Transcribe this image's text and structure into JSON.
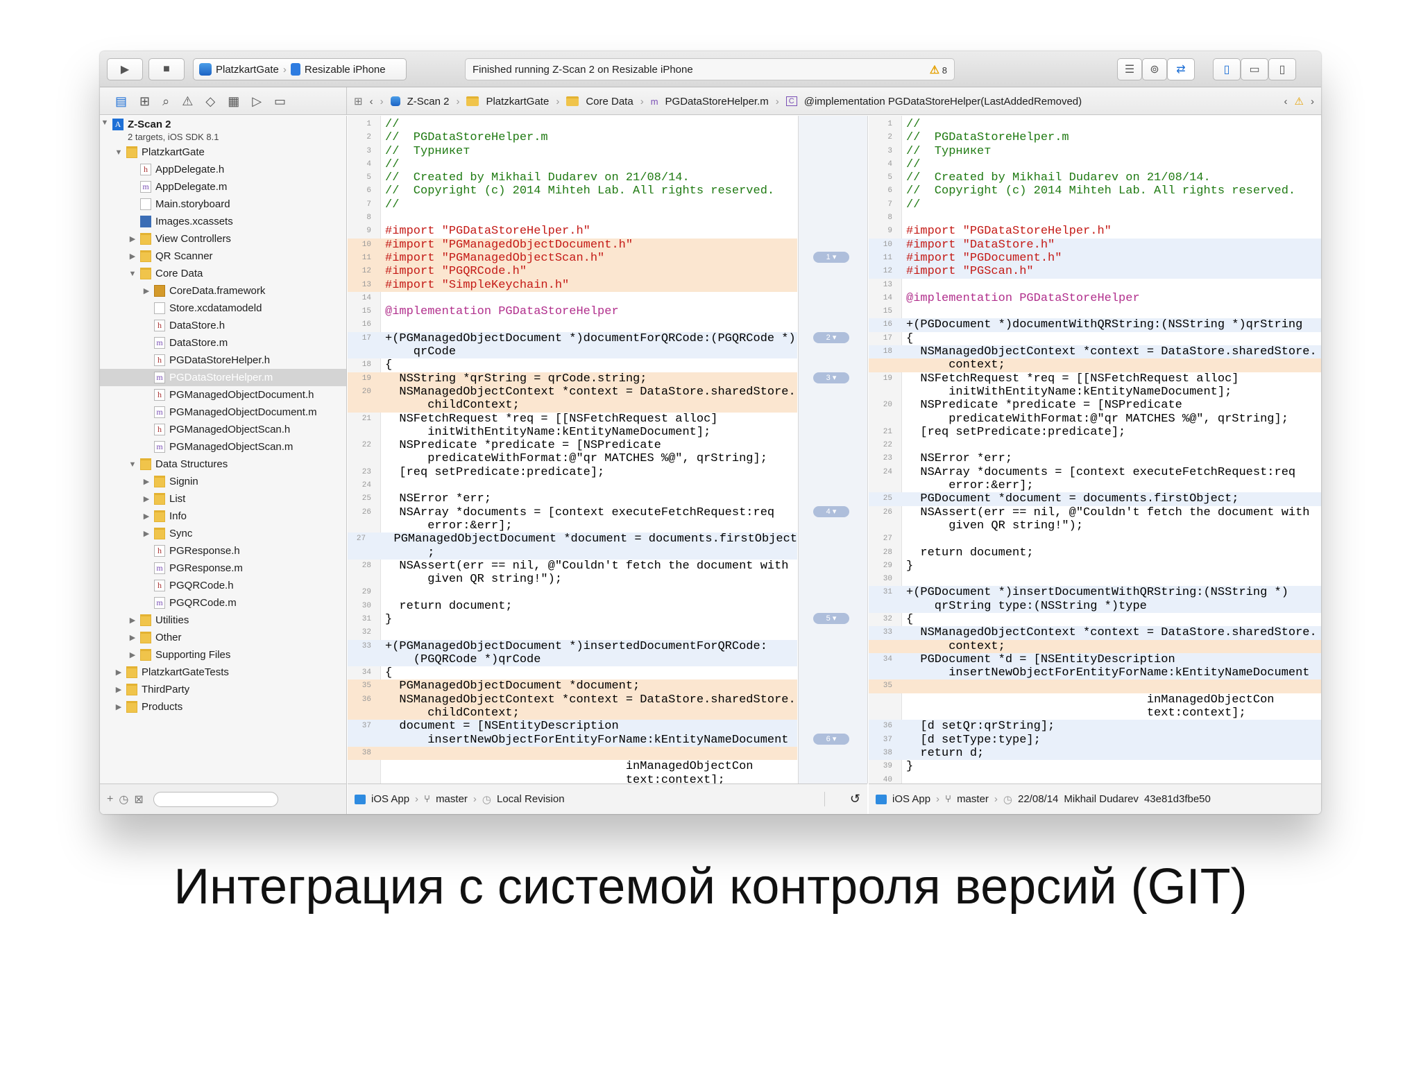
{
  "toolbar": {
    "project": "PlatzkartGate",
    "device": "Resizable iPhone",
    "status": "Finished running Z-Scan 2 on Resizable iPhone",
    "warnings": "8"
  },
  "breadcrumb": [
    "Z-Scan 2",
    "PlatzkartGate",
    "Core Data",
    "PGDataStoreHelper.m",
    "@implementation PGDataStoreHelper(LastAddedRemoved)"
  ],
  "navigator": {
    "project": "Z-Scan 2",
    "project_sub": "2 targets, iOS SDK 8.1",
    "items": [
      {
        "label": "PlatzkartGate",
        "indent": 1,
        "icon": "fo",
        "tri": "▼"
      },
      {
        "label": "AppDelegate.h",
        "indent": 2,
        "icon": "h",
        "tri": ""
      },
      {
        "label": "AppDelegate.m",
        "indent": 2,
        "icon": "m",
        "tri": ""
      },
      {
        "label": "Main.storyboard",
        "indent": 2,
        "icon": "sb",
        "tri": ""
      },
      {
        "label": "Images.xcassets",
        "indent": 2,
        "icon": "xc",
        "tri": ""
      },
      {
        "label": "View Controllers",
        "indent": 2,
        "icon": "fo",
        "tri": "▶"
      },
      {
        "label": "QR Scanner",
        "indent": 2,
        "icon": "fo",
        "tri": "▶"
      },
      {
        "label": "Core Data",
        "indent": 2,
        "icon": "fo",
        "tri": "▼"
      },
      {
        "label": "CoreData.framework",
        "indent": 3,
        "icon": "fw",
        "tri": "▶"
      },
      {
        "label": "Store.xcdatamodeld",
        "indent": 3,
        "icon": "sb",
        "tri": ""
      },
      {
        "label": "DataStore.h",
        "indent": 3,
        "icon": "h",
        "tri": ""
      },
      {
        "label": "DataStore.m",
        "indent": 3,
        "icon": "m",
        "tri": ""
      },
      {
        "label": "PGDataStoreHelper.h",
        "indent": 3,
        "icon": "h",
        "tri": ""
      },
      {
        "label": "PGDataStoreHelper.m",
        "indent": 3,
        "icon": "m",
        "tri": "",
        "selected": true
      },
      {
        "label": "PGManagedObjectDocument.h",
        "indent": 3,
        "icon": "h",
        "tri": ""
      },
      {
        "label": "PGManagedObjectDocument.m",
        "indent": 3,
        "icon": "m",
        "tri": ""
      },
      {
        "label": "PGManagedObjectScan.h",
        "indent": 3,
        "icon": "h",
        "tri": ""
      },
      {
        "label": "PGManagedObjectScan.m",
        "indent": 3,
        "icon": "m",
        "tri": ""
      },
      {
        "label": "Data Structures",
        "indent": 2,
        "icon": "fo",
        "tri": "▼"
      },
      {
        "label": "Signin",
        "indent": 3,
        "icon": "fo",
        "tri": "▶"
      },
      {
        "label": "List",
        "indent": 3,
        "icon": "fo",
        "tri": "▶"
      },
      {
        "label": "Info",
        "indent": 3,
        "icon": "fo",
        "tri": "▶"
      },
      {
        "label": "Sync",
        "indent": 3,
        "icon": "fo",
        "tri": "▶"
      },
      {
        "label": "PGResponse.h",
        "indent": 3,
        "icon": "h",
        "tri": ""
      },
      {
        "label": "PGResponse.m",
        "indent": 3,
        "icon": "m",
        "tri": ""
      },
      {
        "label": "PGQRCode.h",
        "indent": 3,
        "icon": "h",
        "tri": ""
      },
      {
        "label": "PGQRCode.m",
        "indent": 3,
        "icon": "m",
        "tri": ""
      },
      {
        "label": "Utilities",
        "indent": 2,
        "icon": "fo",
        "tri": "▶"
      },
      {
        "label": "Other",
        "indent": 2,
        "icon": "fo",
        "tri": "▶"
      },
      {
        "label": "Supporting Files",
        "indent": 2,
        "icon": "fo",
        "tri": "▶"
      },
      {
        "label": "PlatzkartGateTests",
        "indent": 1,
        "icon": "fo",
        "tri": "▶"
      },
      {
        "label": "ThirdParty",
        "indent": 1,
        "icon": "fo",
        "tri": "▶"
      },
      {
        "label": "Products",
        "indent": 1,
        "icon": "fo",
        "tri": "▶"
      }
    ]
  },
  "left_code": [
    {
      "n": "1",
      "t": "//",
      "c": "cm"
    },
    {
      "n": "2",
      "t": "//  PGDataStoreHelper.m",
      "c": "cm"
    },
    {
      "n": "3",
      "t": "//  Турникет",
      "c": "cm"
    },
    {
      "n": "4",
      "t": "//",
      "c": "cm"
    },
    {
      "n": "5",
      "t": "//  Created by Mikhail Dudarev on 21/08/14.",
      "c": "cm"
    },
    {
      "n": "6",
      "t": "//  Copyright (c) 2014 Mihteh Lab. All rights reserved.",
      "c": "cm"
    },
    {
      "n": "7",
      "t": "//",
      "c": "cm"
    },
    {
      "n": "8",
      "t": "",
      "c": ""
    },
    {
      "n": "9",
      "t": "#import \"PGDataStoreHelper.h\"",
      "c": "str"
    },
    {
      "n": "10",
      "t": "#import \"PGManagedObjectDocument.h\"",
      "c": "str",
      "bg": "chg"
    },
    {
      "n": "11",
      "t": "#import \"PGManagedObjectScan.h\"",
      "c": "str",
      "bg": "chg"
    },
    {
      "n": "12",
      "t": "#import \"PGQRCode.h\"",
      "c": "str",
      "bg": "chg"
    },
    {
      "n": "13",
      "t": "#import \"SimpleKeychain.h\"",
      "c": "str",
      "bg": "chg"
    },
    {
      "n": "14",
      "t": "",
      "c": ""
    },
    {
      "n": "15",
      "t": "@implementation PGDataStoreHelper",
      "c": "kw"
    },
    {
      "n": "16",
      "t": "",
      "c": ""
    },
    {
      "n": "17",
      "t": "+(PGManagedObjectDocument *)documentForQRCode:(PGQRCode *)",
      "c": "",
      "bg": "hl"
    },
    {
      "n": "",
      "t": "    qrCode",
      "c": "",
      "bg": "hl"
    },
    {
      "n": "18",
      "t": "{",
      "c": ""
    },
    {
      "n": "19",
      "t": "  NSString *qrString = qrCode.string;",
      "c": "",
      "bg": "chg"
    },
    {
      "n": "20",
      "t": "  NSManagedObjectContext *context = DataStore.sharedStore.",
      "c": "",
      "bg": "chg"
    },
    {
      "n": "",
      "t": "      childContext;",
      "c": "",
      "bg": "chg"
    },
    {
      "n": "21",
      "t": "  NSFetchRequest *req = [[NSFetchRequest alloc]",
      "c": ""
    },
    {
      "n": "",
      "t": "      initWithEntityName:kEntityNameDocument];",
      "c": ""
    },
    {
      "n": "22",
      "t": "  NSPredicate *predicate = [NSPredicate",
      "c": ""
    },
    {
      "n": "",
      "t": "      predicateWithFormat:@\"qr MATCHES %@\", qrString];",
      "c": ""
    },
    {
      "n": "23",
      "t": "  [req setPredicate:predicate];",
      "c": ""
    },
    {
      "n": "24",
      "t": "",
      "c": ""
    },
    {
      "n": "25",
      "t": "  NSError *err;",
      "c": ""
    },
    {
      "n": "26",
      "t": "  NSArray *documents = [context executeFetchRequest:req",
      "c": ""
    },
    {
      "n": "",
      "t": "      error:&err];",
      "c": ""
    },
    {
      "n": "27",
      "t": "  PGManagedObjectDocument *document = documents.firstObject",
      "c": "",
      "bg": "hl"
    },
    {
      "n": "",
      "t": "      ;",
      "c": "",
      "bg": "hl"
    },
    {
      "n": "28",
      "t": "  NSAssert(err == nil, @\"Couldn't fetch the document with",
      "c": ""
    },
    {
      "n": "",
      "t": "      given QR string!\");",
      "c": ""
    },
    {
      "n": "29",
      "t": "",
      "c": ""
    },
    {
      "n": "30",
      "t": "  return document;",
      "c": ""
    },
    {
      "n": "31",
      "t": "}",
      "c": ""
    },
    {
      "n": "32",
      "t": "",
      "c": ""
    },
    {
      "n": "33",
      "t": "+(PGManagedObjectDocument *)insertedDocumentForQRCode:",
      "c": "",
      "bg": "hl"
    },
    {
      "n": "",
      "t": "    (PGQRCode *)qrCode",
      "c": "",
      "bg": "hl"
    },
    {
      "n": "34",
      "t": "{",
      "c": ""
    },
    {
      "n": "35",
      "t": "  PGManagedObjectDocument *document;",
      "c": "",
      "bg": "chg"
    },
    {
      "n": "36",
      "t": "  NSManagedObjectContext *context = DataStore.sharedStore.",
      "c": "",
      "bg": "chg"
    },
    {
      "n": "",
      "t": "      childContext;",
      "c": "",
      "bg": "chg"
    },
    {
      "n": "37",
      "t": "  document = [NSEntityDescription",
      "c": "",
      "bg": "hl"
    },
    {
      "n": "",
      "t": "      insertNewObjectForEntityForName:kEntityNameDocument",
      "c": "",
      "bg": "hl"
    },
    {
      "n": "38",
      "t": "",
      "c": "",
      "bg": "chg"
    },
    {
      "n": "",
      "t": "                                  inManagedObjectCon",
      "c": ""
    },
    {
      "n": "",
      "t": "                                  text:context];",
      "c": ""
    }
  ],
  "right_code": [
    {
      "n": "1",
      "t": "//",
      "c": "cm"
    },
    {
      "n": "2",
      "t": "//  PGDataStoreHelper.m",
      "c": "cm"
    },
    {
      "n": "3",
      "t": "//  Турникет",
      "c": "cm"
    },
    {
      "n": "4",
      "t": "//",
      "c": "cm"
    },
    {
      "n": "5",
      "t": "//  Created by Mikhail Dudarev on 21/08/14.",
      "c": "cm"
    },
    {
      "n": "6",
      "t": "//  Copyright (c) 2014 Mihteh Lab. All rights reserved.",
      "c": "cm"
    },
    {
      "n": "7",
      "t": "//",
      "c": "cm"
    },
    {
      "n": "8",
      "t": "",
      "c": ""
    },
    {
      "n": "9",
      "t": "#import \"PGDataStoreHelper.h\"",
      "c": "str"
    },
    {
      "n": "10",
      "t": "#import \"DataStore.h\"",
      "c": "str",
      "bg": "hl"
    },
    {
      "n": "11",
      "t": "#import \"PGDocument.h\"",
      "c": "str",
      "bg": "hl"
    },
    {
      "n": "12",
      "t": "#import \"PGScan.h\"",
      "c": "str",
      "bg": "hl"
    },
    {
      "n": "13",
      "t": "",
      "c": ""
    },
    {
      "n": "14",
      "t": "@implementation PGDataStoreHelper",
      "c": "kw"
    },
    {
      "n": "15",
      "t": "",
      "c": ""
    },
    {
      "n": "16",
      "t": "+(PGDocument *)documentWithQRString:(NSString *)qrString",
      "c": "",
      "bg": "hl"
    },
    {
      "n": "17",
      "t": "{",
      "c": ""
    },
    {
      "n": "18",
      "t": "  NSManagedObjectContext *context = DataStore.sharedStore.",
      "c": "",
      "bg": "hl"
    },
    {
      "n": "",
      "t": "      context;",
      "c": "",
      "bg": "chg"
    },
    {
      "n": "19",
      "t": "  NSFetchRequest *req = [[NSFetchRequest alloc]",
      "c": ""
    },
    {
      "n": "",
      "t": "      initWithEntityName:kEntityNameDocument];",
      "c": ""
    },
    {
      "n": "20",
      "t": "  NSPredicate *predicate = [NSPredicate",
      "c": ""
    },
    {
      "n": "",
      "t": "      predicateWithFormat:@\"qr MATCHES %@\", qrString];",
      "c": ""
    },
    {
      "n": "21",
      "t": "  [req setPredicate:predicate];",
      "c": ""
    },
    {
      "n": "22",
      "t": "",
      "c": ""
    },
    {
      "n": "23",
      "t": "  NSError *err;",
      "c": ""
    },
    {
      "n": "24",
      "t": "  NSArray *documents = [context executeFetchRequest:req",
      "c": ""
    },
    {
      "n": "",
      "t": "      error:&err];",
      "c": ""
    },
    {
      "n": "25",
      "t": "  PGDocument *document = documents.firstObject;",
      "c": "",
      "bg": "hl"
    },
    {
      "n": "26",
      "t": "  NSAssert(err == nil, @\"Couldn't fetch the document with",
      "c": ""
    },
    {
      "n": "",
      "t": "      given QR string!\");",
      "c": ""
    },
    {
      "n": "27",
      "t": "",
      "c": ""
    },
    {
      "n": "28",
      "t": "  return document;",
      "c": ""
    },
    {
      "n": "29",
      "t": "}",
      "c": ""
    },
    {
      "n": "30",
      "t": "",
      "c": ""
    },
    {
      "n": "31",
      "t": "+(PGDocument *)insertDocumentWithQRString:(NSString *)",
      "c": "",
      "bg": "hl"
    },
    {
      "n": "",
      "t": "    qrString type:(NSString *)type",
      "c": "",
      "bg": "hl"
    },
    {
      "n": "32",
      "t": "{",
      "c": ""
    },
    {
      "n": "33",
      "t": "  NSManagedObjectContext *context = DataStore.sharedStore.",
      "c": "",
      "bg": "hl"
    },
    {
      "n": "",
      "t": "      context;",
      "c": "",
      "bg": "chg"
    },
    {
      "n": "34",
      "t": "  PGDocument *d = [NSEntityDescription",
      "c": "",
      "bg": "hl"
    },
    {
      "n": "",
      "t": "      insertNewObjectForEntityForName:kEntityNameDocument",
      "c": "",
      "bg": "hl"
    },
    {
      "n": "35",
      "t": "",
      "c": "",
      "bg": "chg"
    },
    {
      "n": "",
      "t": "                                  inManagedObjectCon",
      "c": ""
    },
    {
      "n": "",
      "t": "                                  text:context];",
      "c": ""
    },
    {
      "n": "36",
      "t": "  [d setQr:qrString];",
      "c": "",
      "bg": "hl"
    },
    {
      "n": "37",
      "t": "  [d setType:type];",
      "c": "",
      "bg": "hl"
    },
    {
      "n": "38",
      "t": "  return d;",
      "c": "",
      "bg": "hl"
    },
    {
      "n": "39",
      "t": "}",
      "c": ""
    },
    {
      "n": "40",
      "t": "",
      "c": ""
    }
  ],
  "diff_pills": [
    {
      "label": "1",
      "line": 10
    },
    {
      "label": "2",
      "line": 16
    },
    {
      "label": "3",
      "line": 19
    },
    {
      "label": "4",
      "line": 29
    },
    {
      "label": "5",
      "line": 37
    },
    {
      "label": "6",
      "line": 46
    }
  ],
  "bottom_left": {
    "target": "iOS App",
    "branch": "master",
    "revision": "Local Revision"
  },
  "bottom_right": {
    "target": "iOS App",
    "branch": "master",
    "date": "22/08/14",
    "author": "Mikhail Dudarev",
    "hash": "43e81d3fbe50"
  },
  "caption": "Интеграция с системой контроля версий (GIT)",
  "colors": {
    "comment": "#1f7a12",
    "keyword": "#b12f8c",
    "string": "#c41a16",
    "diff_highlight": "#e9f0fa",
    "diff_change": "#fbe6d0"
  }
}
